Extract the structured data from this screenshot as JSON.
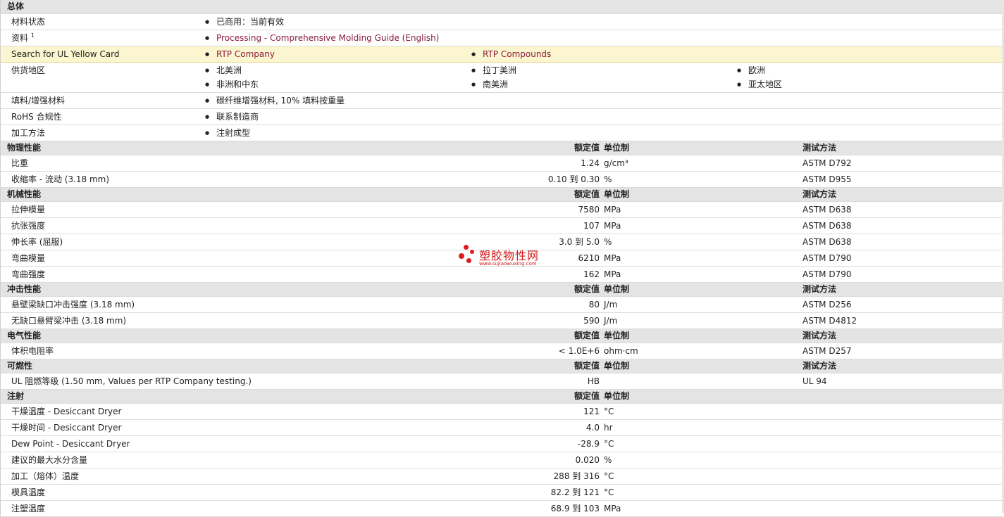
{
  "general": {
    "section_title": "总体",
    "rows": [
      {
        "label": "材料状态",
        "items": [
          "已商用：当前有效"
        ],
        "links": false
      },
      {
        "label": "资料",
        "sup": "1",
        "items": [
          "Processing - Comprehensive Molding Guide (English)"
        ],
        "links": true
      },
      {
        "label": "Search for UL Yellow Card",
        "items": [
          "RTP Company",
          "RTP Compounds"
        ],
        "links": true,
        "highlight": true
      },
      {
        "label": "供货地区",
        "items": [
          "北美洲",
          "拉丁美洲",
          "欧洲",
          "非洲和中东",
          "南美洲",
          "亚太地区"
        ],
        "links": false
      },
      {
        "label": "填料/增强材料",
        "items": [
          "碳纤维增强材料, 10% 填料按重量"
        ],
        "links": false
      },
      {
        "label": "RoHS 合规性",
        "items": [
          "联系制造商"
        ],
        "links": false
      },
      {
        "label": "加工方法",
        "items": [
          "注射成型"
        ],
        "links": false
      }
    ]
  },
  "column_headers": {
    "value": "额定值",
    "unit": "单位制",
    "test": "测试方法"
  },
  "sections": [
    {
      "title": "物理性能",
      "show_test": true,
      "rows": [
        {
          "label": "比重",
          "value": "1.24",
          "unit": "g/cm³",
          "test": "ASTM D792"
        },
        {
          "label": "收缩率  - 流动  (3.18 mm)",
          "value": "0.10 到  0.30",
          "unit": "%",
          "test": "ASTM D955"
        }
      ]
    },
    {
      "title": "机械性能",
      "show_test": true,
      "rows": [
        {
          "label": "拉伸模量",
          "value": "7580",
          "unit": "MPa",
          "test": "ASTM D638"
        },
        {
          "label": "抗张强度",
          "value": "107",
          "unit": "MPa",
          "test": "ASTM D638"
        },
        {
          "label": "伸长率  (屈服)",
          "value": "3.0 到  5.0",
          "unit": "%",
          "test": "ASTM D638"
        },
        {
          "label": "弯曲模量",
          "value": "6210",
          "unit": "MPa",
          "test": "ASTM D790"
        },
        {
          "label": "弯曲强度",
          "value": "162",
          "unit": "MPa",
          "test": "ASTM D790"
        }
      ]
    },
    {
      "title": "冲击性能",
      "show_test": true,
      "rows": [
        {
          "label": "悬壁梁缺口冲击强度  (3.18 mm)",
          "value": "80",
          "unit": "J/m",
          "test": "ASTM D256"
        },
        {
          "label": "无缺口悬臂梁冲击  (3.18 mm)",
          "value": "590",
          "unit": "J/m",
          "test": "ASTM D4812"
        }
      ]
    },
    {
      "title": "电气性能",
      "show_test": true,
      "rows": [
        {
          "label": "体积电阻率",
          "value": "< 1.0E+6",
          "unit": "ohm·cm",
          "test": "ASTM D257"
        }
      ]
    },
    {
      "title": "可燃性",
      "show_test": true,
      "rows": [
        {
          "label": "UL 阻燃等级  (1.50 mm, Values per RTP Company testing.)",
          "value": "HB",
          "unit": "",
          "test": "UL 94"
        }
      ]
    },
    {
      "title": "注射",
      "show_test": false,
      "rows": [
        {
          "label": "干燥温度  - Desiccant Dryer",
          "value": "121",
          "unit": "°C",
          "test": ""
        },
        {
          "label": "干燥时间  - Desiccant Dryer",
          "value": "4.0",
          "unit": "hr",
          "test": ""
        },
        {
          "label": "Dew Point - Desiccant Dryer",
          "value": "-28.9",
          "unit": "°C",
          "test": ""
        },
        {
          "label": "建议的最大水分含量",
          "value": "0.020",
          "unit": "%",
          "test": ""
        },
        {
          "label": "加工（熔体）温度",
          "value": "288 到  316",
          "unit": "°C",
          "test": ""
        },
        {
          "label": "模具温度",
          "value": "82.2 到  121",
          "unit": "°C",
          "test": ""
        },
        {
          "label": "注塑温度",
          "value": "68.9 到  103",
          "unit": "MPa",
          "test": ""
        }
      ]
    }
  ],
  "watermark": {
    "text": "塑胶物性网",
    "url": "www.sujiaowuxing.com",
    "color": "#d01818"
  }
}
